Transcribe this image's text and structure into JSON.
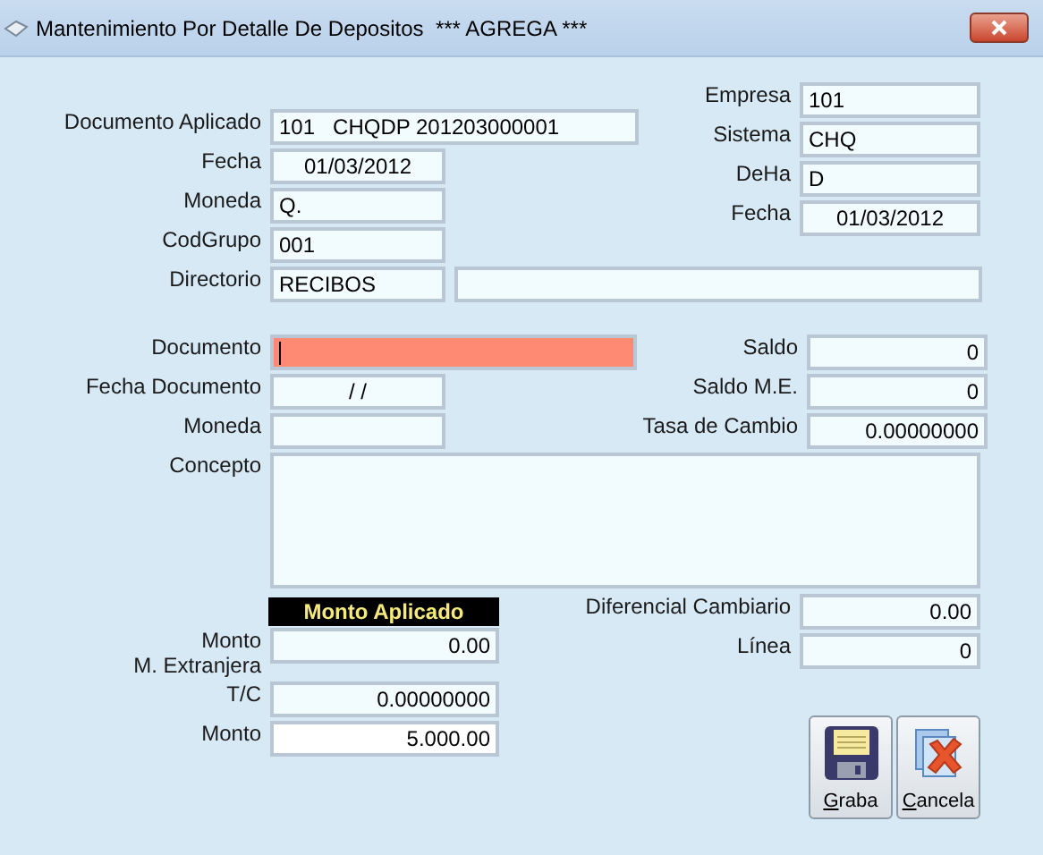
{
  "window": {
    "title": "Mantenimiento Por Detalle De Depositos  *** AGREGA ***"
  },
  "header": {
    "left": [
      {
        "label": "Documento Aplicado",
        "value": "101   CHQDP 201203000001"
      },
      {
        "label": "Fecha",
        "value": "01/03/2012"
      },
      {
        "label": "Moneda",
        "value": "Q."
      },
      {
        "label": "CodGrupo",
        "value": "001"
      }
    ],
    "right": [
      {
        "label": "Empresa",
        "value": "101"
      },
      {
        "label": "Sistema",
        "value": "CHQ"
      },
      {
        "label": "DeHa",
        "value": "D"
      },
      {
        "label": "Fecha",
        "value": "01/03/2012"
      }
    ],
    "directorio": {
      "label": "Directorio",
      "value": "RECIBOS"
    }
  },
  "detail": {
    "left": [
      {
        "label": "Documento",
        "focused": true
      },
      {
        "label": "Fecha Documento",
        "value": "/ /",
        "focused": false
      },
      {
        "label": "Moneda",
        "focused": false
      }
    ],
    "right": [
      {
        "label": "Saldo",
        "value": "0"
      },
      {
        "label": "Saldo M.E.",
        "value": "0"
      },
      {
        "label": "Tasa de Cambio",
        "value": "0.00000000"
      }
    ],
    "concepto": {
      "label": "Concepto"
    }
  },
  "monto_aplicado": {
    "header": "Monto Aplicado",
    "rows": [
      {
        "label": "Monto\nM. Extranjera",
        "value": "0.00",
        "editable": false
      },
      {
        "label": "T/C",
        "value": "0.00000000",
        "editable": false
      },
      {
        "label": "Monto",
        "value": "5.000.00",
        "editable": true
      }
    ]
  },
  "right_bottom": [
    {
      "label": "Diferencial Cambiario",
      "value": "0.00"
    },
    {
      "label": "Línea",
      "value": "0"
    }
  ],
  "buttons": [
    {
      "label": "Graba",
      "kind": "save"
    },
    {
      "label": "Cancela",
      "kind": "cancel"
    }
  ]
}
